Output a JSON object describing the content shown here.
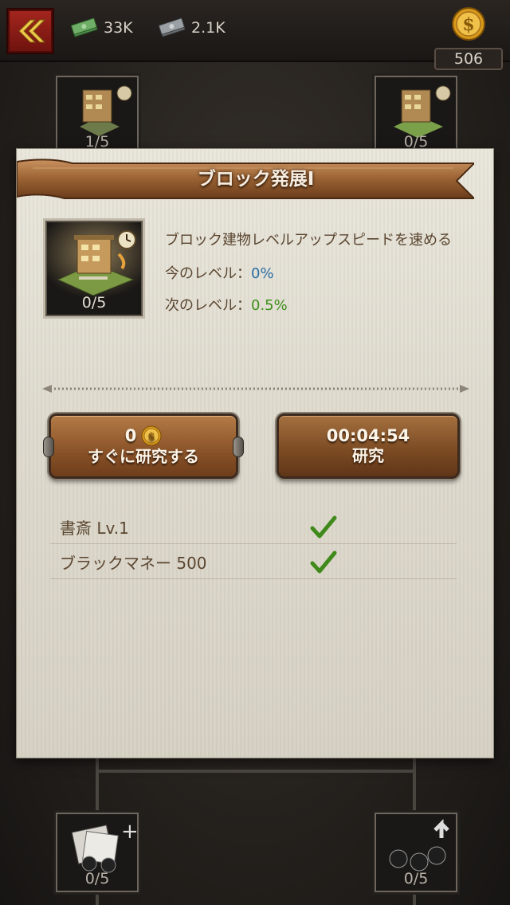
{
  "header": {
    "back_icon": "double-chevron-left-icon",
    "cash": "33K",
    "black_money": "2.1K",
    "gold": "506"
  },
  "tree": {
    "nodes": [
      {
        "name": "tree-node-top-left",
        "count": "1/5"
      },
      {
        "name": "tree-node-top-right",
        "count": "0/5"
      },
      {
        "name": "tree-node-bottom-left",
        "count": "0/5"
      },
      {
        "name": "tree-node-bottom-right",
        "count": "0/5"
      }
    ]
  },
  "dialog": {
    "title": "ブロック発展I",
    "item_count": "0/5",
    "description": "ブロック建物レベルアップスピードを速める",
    "current_level_label": "今のレベル：",
    "current_level_value": "0%",
    "next_level_label": "次のレベル：",
    "next_level_value": "0.5%",
    "instant_button": {
      "cost": "0",
      "label": "すぐに研究する"
    },
    "research_button": {
      "time": "00:04:54",
      "label": "研究"
    },
    "requirements": [
      {
        "label": "書斎 Lv.1",
        "met": true
      },
      {
        "label": "ブラックマネー 500",
        "met": true
      }
    ]
  },
  "colors": {
    "accent_gold": "#e0a521",
    "current_value": "#2b6ea3",
    "next_value": "#3e8f1d",
    "check": "#3f8a1a"
  }
}
